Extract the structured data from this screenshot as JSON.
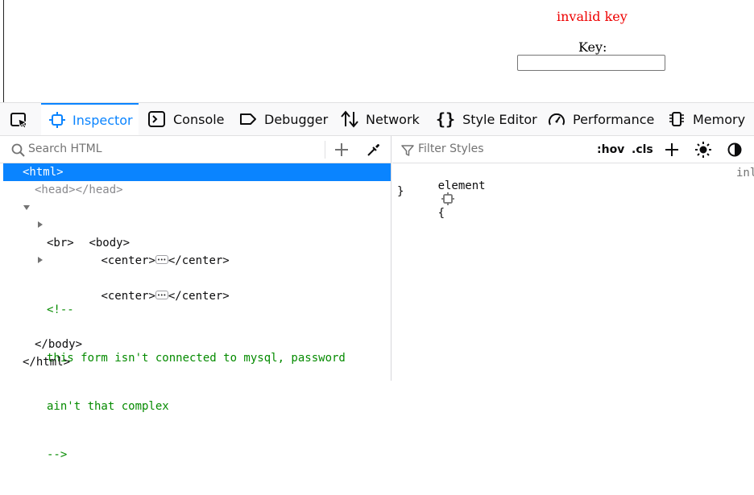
{
  "page": {
    "error_text": "invalid key",
    "key_label": "Key:",
    "key_input_value": ""
  },
  "toolbar": {
    "tabs": [
      {
        "label": "Inspector",
        "icon": "inspector-icon",
        "active": true
      },
      {
        "label": "Console",
        "icon": "console-icon"
      },
      {
        "label": "Debugger",
        "icon": "debugger-icon"
      },
      {
        "label": "Network",
        "icon": "network-icon"
      },
      {
        "label": "Style Editor",
        "icon": "style-editor-icon"
      },
      {
        "label": "Performance",
        "icon": "performance-icon"
      },
      {
        "label": "Memory",
        "icon": "memory-icon"
      }
    ]
  },
  "markup": {
    "search_placeholder": "Search HTML",
    "nodes": {
      "html_open": "<html>",
      "head_open": "<head>",
      "head_close": "</head>",
      "body_open": "<body>",
      "center1_open": "<center>",
      "center1_close": "</center>",
      "br": "<br>",
      "center2_open": "<center>",
      "center2_close": "</center>",
      "comment_open": "<!--",
      "comment_line1": "this form isn't connected to mysql, password",
      "comment_line2": "ain't that complex",
      "comment_close": "-->",
      "body_close": "</body>",
      "html_close": "</html>"
    }
  },
  "rules": {
    "filter_placeholder": "Filter Styles",
    "hov_label": ":hov",
    "cls_label": ".cls",
    "element_selector": "element",
    "open_brace": "{",
    "close_brace": "}",
    "source_label": "inl"
  },
  "colors": {
    "accent": "#0a84ff",
    "error": "#ee0000",
    "comment": "#058b00",
    "tag": "#0074e8"
  }
}
